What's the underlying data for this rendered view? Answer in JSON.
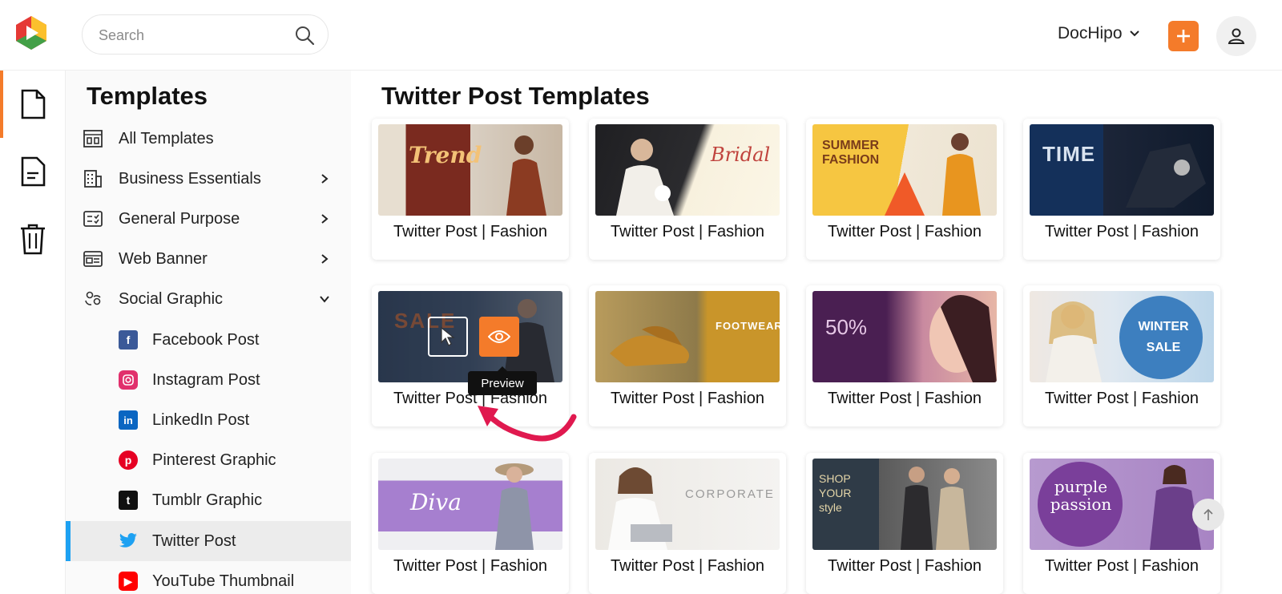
{
  "header": {
    "search_placeholder": "Search",
    "brand_label": "DocHipo",
    "add_icon": "plus-icon",
    "user_icon": "user-icon"
  },
  "colors": {
    "accent": "#f47b2a",
    "twitter": "#1da1f2"
  },
  "rail": {
    "items": [
      "document-icon",
      "file-text-icon",
      "trash-icon"
    ]
  },
  "sidebar": {
    "title": "Templates",
    "items": [
      {
        "label": "All Templates",
        "icon": "grid-icon"
      },
      {
        "label": "Business Essentials",
        "icon": "building-icon"
      },
      {
        "label": "General Purpose",
        "icon": "checklist-icon"
      },
      {
        "label": "Web Banner",
        "icon": "banner-icon"
      },
      {
        "label": "Social Graphic",
        "icon": "social-users-icon"
      }
    ],
    "subitems": [
      {
        "label": "Facebook Post",
        "icon": "facebook-icon"
      },
      {
        "label": "Instagram Post",
        "icon": "instagram-icon"
      },
      {
        "label": "LinkedIn Post",
        "icon": "linkedin-icon"
      },
      {
        "label": "Pinterest Graphic",
        "icon": "pinterest-icon"
      },
      {
        "label": "Tumblr Graphic",
        "icon": "tumblr-icon"
      },
      {
        "label": "Twitter Post",
        "icon": "twitter-icon"
      },
      {
        "label": "YouTube Thumbnail",
        "icon": "youtube-icon"
      }
    ]
  },
  "main": {
    "title": "Twitter Post Templates",
    "cards": [
      {
        "caption": "Twitter Post | Fashion",
        "thumb_text": "Trend"
      },
      {
        "caption": "Twitter Post | Fashion",
        "thumb_text": "Bridal"
      },
      {
        "caption": "Twitter Post | Fashion",
        "thumb_text": "SUMMER FASHION"
      },
      {
        "caption": "Twitter Post | Fashion",
        "thumb_text": "TIME"
      },
      {
        "caption": "Twitter Post | Fashion",
        "thumb_text": "SALE"
      },
      {
        "caption": "Twitter Post | Fashion",
        "thumb_text": "FOOTWEAR"
      },
      {
        "caption": "Twitter Post | Fashion",
        "thumb_text": "50%"
      },
      {
        "caption": "Twitter Post | Fashion",
        "thumb_text": "WINTER SALE"
      },
      {
        "caption": "Twitter Post | Fashion",
        "thumb_text": "Diva"
      },
      {
        "caption": "Twitter Post | Fashion",
        "thumb_text": "CORPORATE"
      },
      {
        "caption": "Twitter Post | Fashion",
        "thumb_text": "SHOP YOUR style"
      },
      {
        "caption": "Twitter Post | Fashion",
        "thumb_text": "purple passion"
      }
    ],
    "tooltip": "Preview"
  }
}
